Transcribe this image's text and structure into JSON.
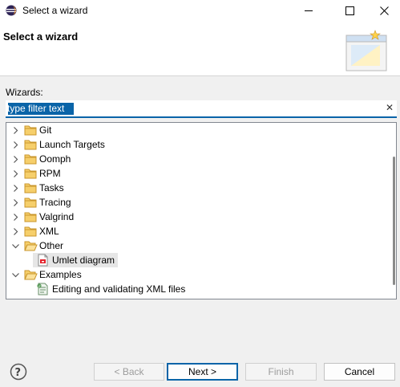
{
  "window": {
    "title": "Select a wizard"
  },
  "header": {
    "title": "Select a wizard"
  },
  "filter": {
    "label": "Wizards:",
    "value": "type filter text"
  },
  "tree": {
    "items": [
      {
        "label": "Git"
      },
      {
        "label": "Launch Targets"
      },
      {
        "label": "Oomph"
      },
      {
        "label": "RPM"
      },
      {
        "label": "Tasks"
      },
      {
        "label": "Tracing"
      },
      {
        "label": "Valgrind"
      },
      {
        "label": "XML"
      },
      {
        "label": "Other"
      },
      {
        "label": "Umlet diagram"
      },
      {
        "label": "Examples"
      },
      {
        "label": "Editing and validating XML files"
      }
    ]
  },
  "buttons": {
    "back": "< Back",
    "next": "Next >",
    "finish": "Finish",
    "cancel": "Cancel"
  },
  "colors": {
    "accent": "#0a64a8",
    "folder": "#e9b44c",
    "selection": "#e6e6e6"
  }
}
